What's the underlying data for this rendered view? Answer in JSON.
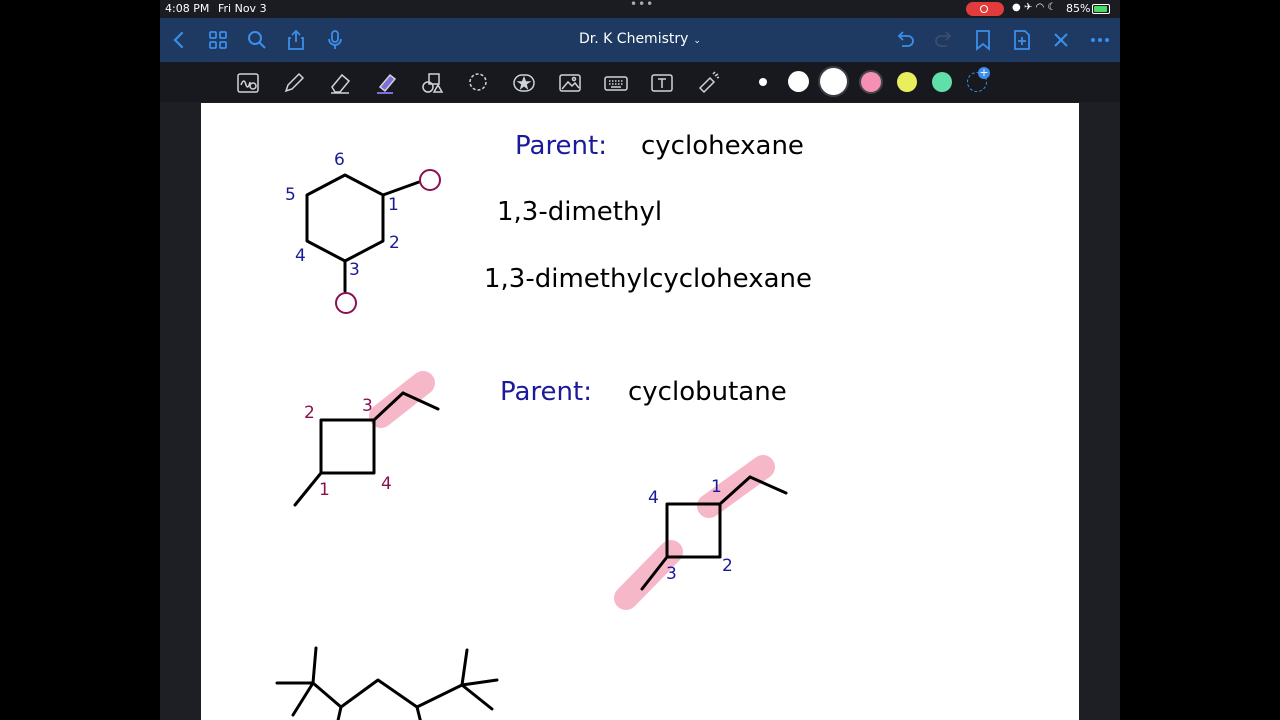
{
  "status_bar": {
    "time": "4:08 PM",
    "date": "Fri Nov 3",
    "battery": "85%"
  },
  "nav": {
    "title": "Dr. K Chemistry",
    "back_icon": "chevron-left-icon",
    "grid_icon": "grid-icon",
    "search_icon": "search-icon",
    "share_icon": "share-icon",
    "mic_icon": "microphone-icon",
    "undo_icon": "undo-icon",
    "redo_icon": "redo-icon",
    "bookmark_icon": "bookmark-icon",
    "add_page_icon": "add-page-icon",
    "close_icon": "close-icon",
    "more_icon": "more-icon"
  },
  "colors": {
    "nav_bg": "#1e3a63",
    "accent": "#3b8eea",
    "ink_blue": "#1a1a9a",
    "ink_magenta": "#8a1050",
    "highlight": "#f6b7c8",
    "swatches": [
      "#ffffff",
      "#ffffff",
      "#ffffff",
      "#f58fb3",
      "#e9ef5c",
      "#5fe0a8"
    ]
  },
  "notes": {
    "block1": {
      "parent_label": "Parent:",
      "parent_value": "cyclohexane",
      "line2": "1,3-dimethyl",
      "line3": "1,3-dimethylcyclohexane",
      "ring_numbers": [
        "6",
        "5",
        "1",
        "4",
        "2",
        "3"
      ]
    },
    "block2": {
      "parent_label": "Parent:",
      "parent_value": "cyclobutane",
      "left_numbers": [
        "2",
        "3",
        "1",
        "4"
      ],
      "right_numbers": [
        "4",
        "1",
        "3",
        "2"
      ]
    }
  }
}
